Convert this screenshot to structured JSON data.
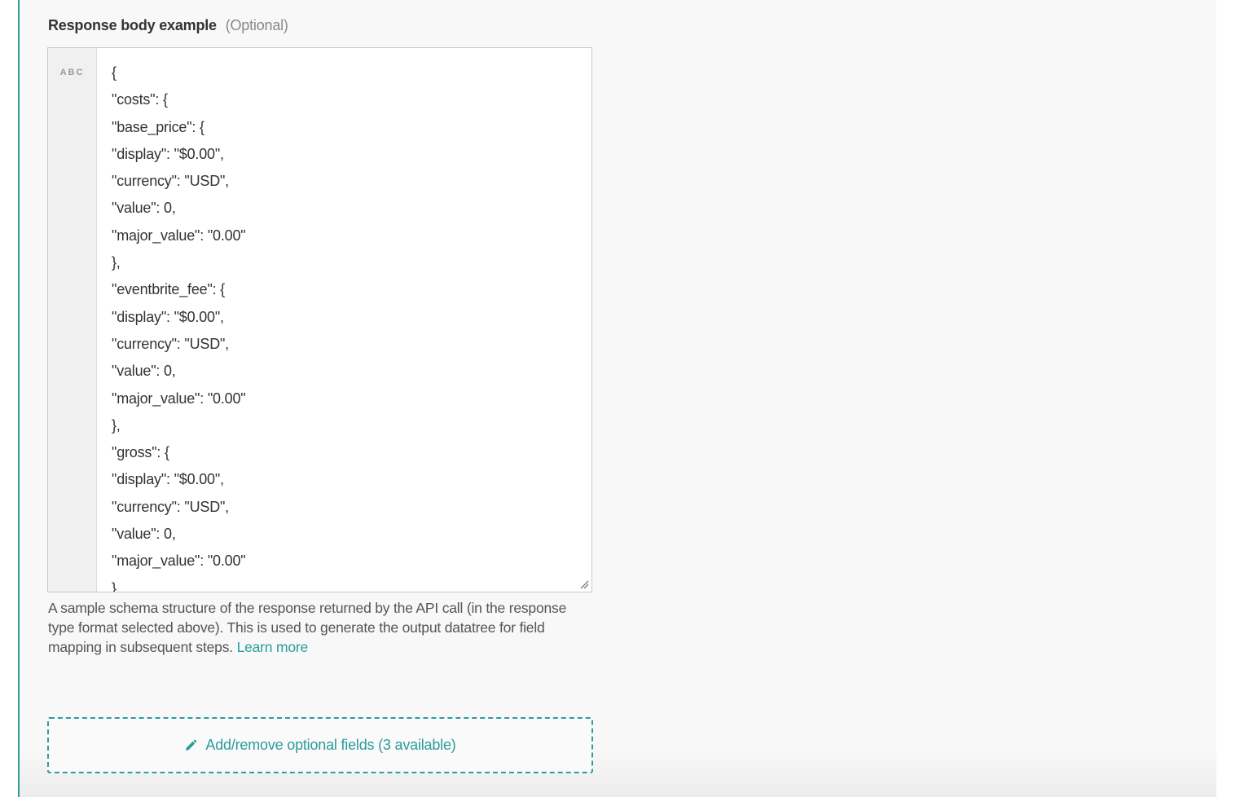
{
  "field": {
    "label": "Response body example",
    "optional_text": "(Optional)",
    "gutter_type": "ABC",
    "lines": [
      "{",
      "\"costs\": {",
      "\"base_price\": {",
      "\"display\": \"$0.00\",",
      "\"currency\": \"USD\",",
      "\"value\": 0,",
      "\"major_value\": \"0.00\"",
      "},",
      "\"eventbrite_fee\": {",
      "\"display\": \"$0.00\",",
      "\"currency\": \"USD\",",
      "\"value\": 0,",
      "\"major_value\": \"0.00\"",
      "},",
      "\"gross\": {",
      "\"display\": \"$0.00\",",
      "\"currency\": \"USD\",",
      "\"value\": 0,",
      "\"major_value\": \"0.00\"",
      "},"
    ],
    "help_text": "A sample schema structure of the response returned by the API call (in the response type format selected above). This is used to generate the output datatree for field mapping in subsequent steps.",
    "learn_more": "Learn more"
  },
  "optional_fields": {
    "label": "Add/remove optional fields (3 available)",
    "icon": "pencil-icon"
  },
  "colors": {
    "accent": "#2b9c9c",
    "text": "#333333",
    "muted": "#888888"
  }
}
